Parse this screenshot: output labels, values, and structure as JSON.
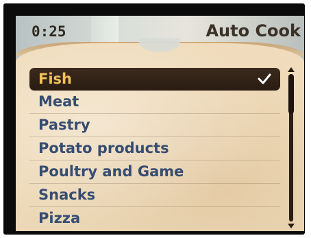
{
  "status": {
    "time": "0:25"
  },
  "header": {
    "title": "Auto Cook"
  },
  "menu": {
    "items": [
      {
        "label": "Fish",
        "selected": true
      },
      {
        "label": "Meat",
        "selected": false
      },
      {
        "label": "Pastry",
        "selected": false
      },
      {
        "label": "Potato products",
        "selected": false
      },
      {
        "label": "Poultry and Game",
        "selected": false
      },
      {
        "label": "Snacks",
        "selected": false
      },
      {
        "label": "Pizza",
        "selected": false
      }
    ]
  },
  "icons": {
    "selected_marker": "checkmark-icon",
    "scroll_up": "arrow-up-icon",
    "scroll_down": "arrow-down-icon"
  },
  "colors": {
    "selected_bg": "#2f2015",
    "selected_text": "#f2c15a",
    "item_text": "#364d72",
    "frame": "#0b0b0b"
  }
}
